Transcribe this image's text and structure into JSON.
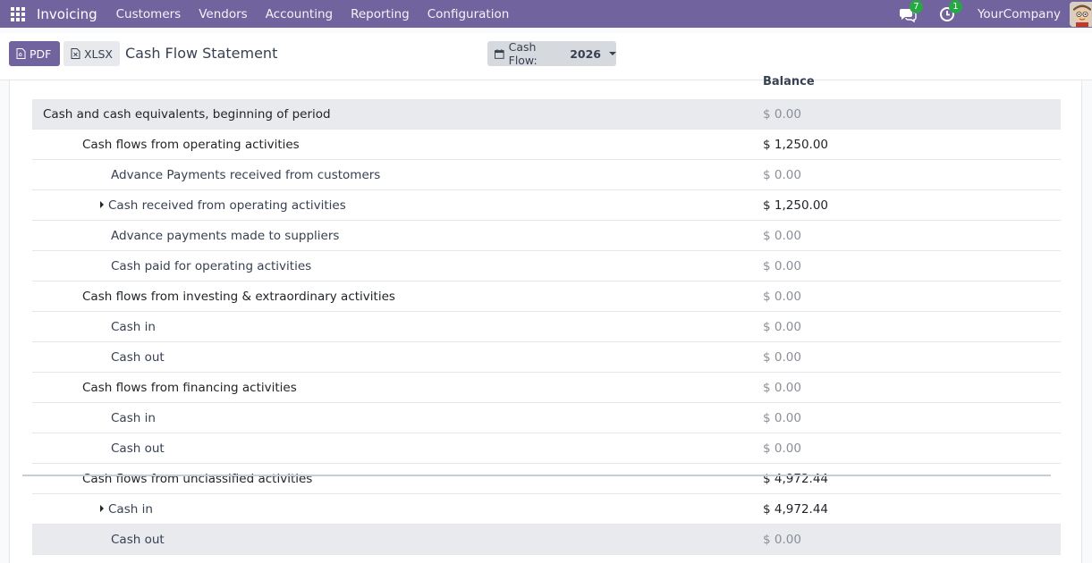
{
  "navbar": {
    "app_name": "Invoicing",
    "menu": [
      "Customers",
      "Vendors",
      "Accounting",
      "Reporting",
      "Configuration"
    ],
    "messages_count": "7",
    "activities_count": "1",
    "company": "YourCompany",
    "bg_color": "#71639e"
  },
  "control": {
    "pdf_label": "PDF",
    "xlsx_label": "XLSX",
    "title": "Cash Flow Statement",
    "filter_prefix": "Cash Flow:",
    "filter_value": "2026"
  },
  "report": {
    "column_header": "Balance",
    "rows": [
      {
        "label": "Cash and cash equivalents, beginning of period",
        "amount": "$ 0.00"
      },
      {
        "label": "Cash flows from operating activities",
        "amount": "$ 1,250.00"
      },
      {
        "label": "Advance Payments received from customers",
        "amount": "$ 0.00"
      },
      {
        "label": "Cash received from operating activities",
        "amount": "$ 1,250.00"
      },
      {
        "label": "Advance payments made to suppliers",
        "amount": "$ 0.00"
      },
      {
        "label": "Cash paid for operating activities",
        "amount": "$ 0.00"
      },
      {
        "label": "Cash flows from investing & extraordinary activities",
        "amount": "$ 0.00"
      },
      {
        "label": "Cash in",
        "amount": "$ 0.00"
      },
      {
        "label": "Cash out",
        "amount": "$ 0.00"
      },
      {
        "label": "Cash flows from financing activities",
        "amount": "$ 0.00"
      },
      {
        "label": "Cash in",
        "amount": "$ 0.00"
      },
      {
        "label": "Cash out",
        "amount": "$ 0.00"
      },
      {
        "label": "Cash flows from unclassified activities",
        "amount": "$ 4,972.44"
      },
      {
        "label": "Cash in",
        "amount": "$ 4,972.44"
      },
      {
        "label": "Cash out",
        "amount": "$ 0.00"
      }
    ]
  }
}
